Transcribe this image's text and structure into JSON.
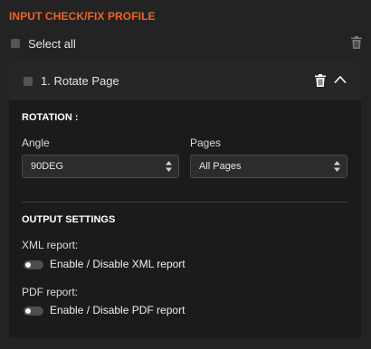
{
  "header": {
    "title": "INPUT CHECK/FIX PROFILE"
  },
  "select_all": {
    "label": "Select all",
    "checked": false
  },
  "card": {
    "label": "1.  Rotate Page",
    "checked": false,
    "rotation": {
      "section_title": "ROTATION :",
      "angle": {
        "label": "Angle",
        "value": "90DEG"
      },
      "pages": {
        "label": "Pages",
        "value": "All Pages"
      }
    },
    "output": {
      "section_title": "OUTPUT SETTINGS",
      "xml": {
        "label": "XML report:",
        "toggle_label": "Enable / Disable XML report",
        "enabled": false
      },
      "pdf": {
        "label": "PDF report:",
        "toggle_label": "Enable / Disable PDF report",
        "enabled": false
      }
    }
  },
  "colors": {
    "accent": "#f26322",
    "background": "#232323",
    "card": "#1b1b1b"
  },
  "icons": [
    "trash-icon",
    "chevron-up-icon",
    "sort-arrows-icon"
  ]
}
